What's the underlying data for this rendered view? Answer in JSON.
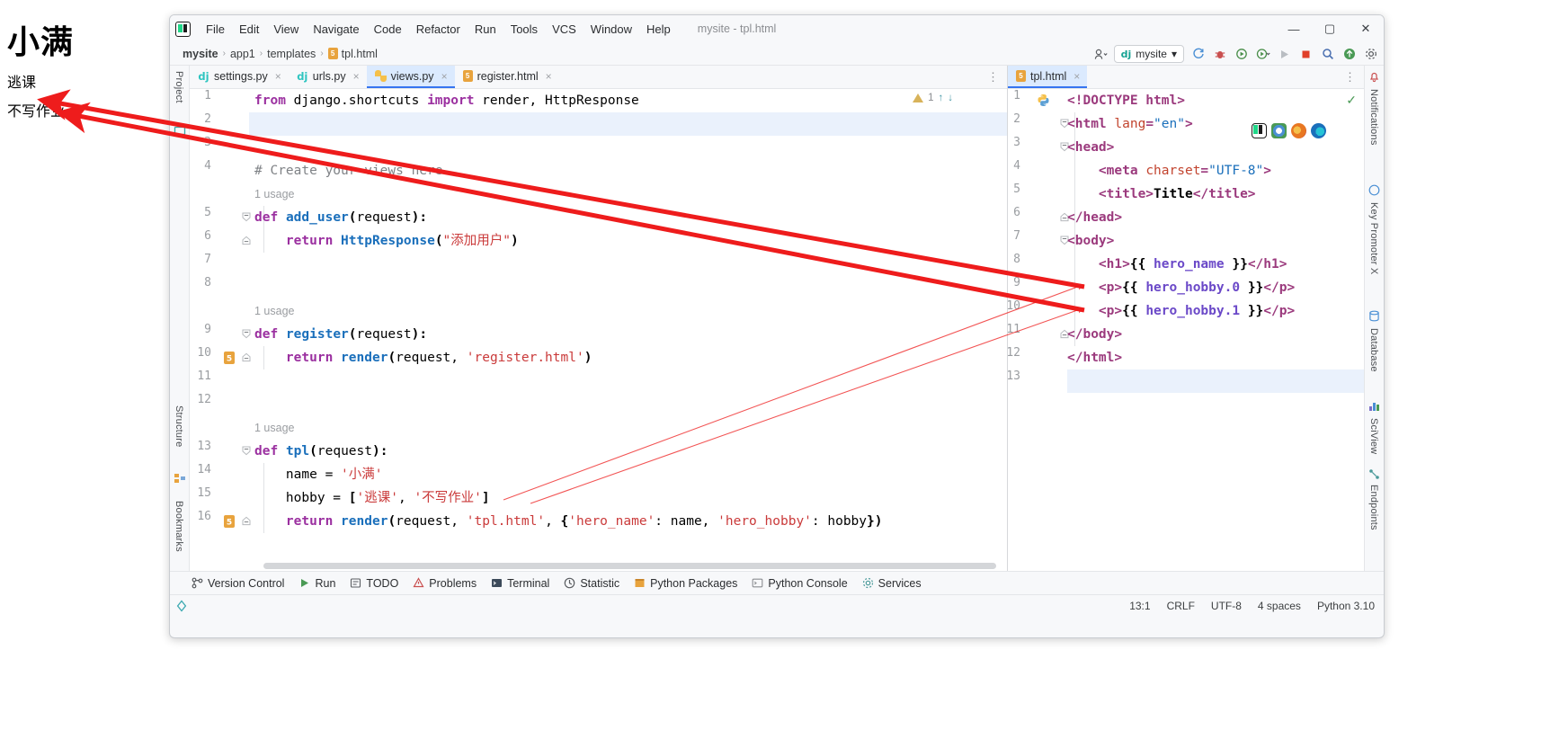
{
  "browser_page": {
    "heading": "小满",
    "paragraph_1": "逃课",
    "paragraph_2": "不写作业"
  },
  "window": {
    "title": "mysite - tpl.html",
    "minimize_label": "—",
    "maximize_label": "▢",
    "close_label": "✕"
  },
  "menu": {
    "items": [
      {
        "label": "File"
      },
      {
        "label": "Edit"
      },
      {
        "label": "View"
      },
      {
        "label": "Navigate"
      },
      {
        "label": "Code"
      },
      {
        "label": "Refactor"
      },
      {
        "label": "Run"
      },
      {
        "label": "Tools"
      },
      {
        "label": "VCS"
      },
      {
        "label": "Window"
      },
      {
        "label": "Help"
      }
    ]
  },
  "breadcrumb": {
    "items": [
      "mysite",
      "app1",
      "templates",
      "tpl.html"
    ],
    "separator": "›"
  },
  "navbar_right": {
    "run_config": "mysite",
    "dj_badge": "dj",
    "chevron": "▾",
    "icons": [
      "reload-icon",
      "debug-icon",
      "run-with-coverage-icon",
      "profile-icon",
      "run-icon",
      "stop-icon",
      "search-icon",
      "git-update-icon",
      "settings-icon"
    ],
    "user_icon": "user-icon"
  },
  "left_rail": {
    "items": [
      "Project",
      "Structure",
      "Bookmarks"
    ]
  },
  "right_rail": {
    "items": [
      "Notifications",
      "Key Promoter X",
      "Database",
      "SciView",
      "Endpoints"
    ]
  },
  "editor_left": {
    "tabs": [
      {
        "label": "settings.py",
        "icon": "django-icon",
        "active": false,
        "close": "×"
      },
      {
        "label": "urls.py",
        "icon": "django-icon",
        "active": false,
        "close": "×"
      },
      {
        "label": "views.py",
        "icon": "python-icon",
        "active": true,
        "close": "×"
      },
      {
        "label": "register.html",
        "icon": "html5-icon",
        "active": false,
        "close": "×"
      }
    ],
    "inspection": {
      "warning_count": "1",
      "up": "↑",
      "down": "↓"
    },
    "lines": [
      {
        "num": "1",
        "gutter": "",
        "fold": "",
        "tokens": [
          [
            "k",
            "from"
          ],
          [
            "pl",
            " django.shortcuts "
          ],
          [
            "k",
            "import"
          ],
          [
            "pl",
            " render, HttpResponse"
          ]
        ]
      },
      {
        "num": "2",
        "gutter": "",
        "fold": "",
        "tokens": [],
        "current": true
      },
      {
        "num": "3",
        "gutter": "",
        "fold": "",
        "tokens": []
      },
      {
        "num": "4",
        "gutter": "",
        "fold": "",
        "tokens": [
          [
            "cm",
            "# Create your views here."
          ]
        ]
      },
      {
        "num": "",
        "gutter": "",
        "fold": "",
        "hint": "1 usage"
      },
      {
        "num": "5",
        "gutter": "",
        "fold": "open",
        "tokens": [
          [
            "k",
            "def"
          ],
          [
            "pl",
            " "
          ],
          [
            "fn",
            "add_user"
          ],
          [
            "bk",
            "("
          ],
          [
            "pl",
            "request"
          ],
          [
            "bk",
            "):"
          ]
        ]
      },
      {
        "num": "6",
        "gutter": "",
        "fold": "end",
        "tokens": [
          [
            "pl",
            "    "
          ],
          [
            "k",
            "return"
          ],
          [
            "pl",
            " "
          ],
          [
            "fn",
            "HttpResponse"
          ],
          [
            "bk",
            "("
          ],
          [
            "s",
            "\"添加用户\""
          ],
          [
            "bk",
            ")"
          ]
        ]
      },
      {
        "num": "7",
        "gutter": "",
        "fold": "",
        "tokens": []
      },
      {
        "num": "8",
        "gutter": "",
        "fold": "",
        "tokens": []
      },
      {
        "num": "",
        "gutter": "",
        "fold": "",
        "hint": "1 usage"
      },
      {
        "num": "9",
        "gutter": "",
        "fold": "open",
        "tokens": [
          [
            "k",
            "def"
          ],
          [
            "pl",
            " "
          ],
          [
            "fn",
            "register"
          ],
          [
            "bk",
            "("
          ],
          [
            "pl",
            "request"
          ],
          [
            "bk",
            "):"
          ]
        ]
      },
      {
        "num": "10",
        "gutter": "html5-icon",
        "fold": "end",
        "tokens": [
          [
            "pl",
            "    "
          ],
          [
            "k",
            "return"
          ],
          [
            "pl",
            " "
          ],
          [
            "fn",
            "render"
          ],
          [
            "bk",
            "("
          ],
          [
            "pl",
            "request, "
          ],
          [
            "s",
            "'register.html'"
          ],
          [
            "bk",
            ")"
          ]
        ]
      },
      {
        "num": "11",
        "gutter": "",
        "fold": "",
        "tokens": []
      },
      {
        "num": "12",
        "gutter": "",
        "fold": "",
        "tokens": []
      },
      {
        "num": "",
        "gutter": "",
        "fold": "",
        "hint": "1 usage"
      },
      {
        "num": "13",
        "gutter": "",
        "fold": "open",
        "tokens": [
          [
            "k",
            "def"
          ],
          [
            "pl",
            " "
          ],
          [
            "fn",
            "tpl"
          ],
          [
            "bk",
            "("
          ],
          [
            "pl",
            "request"
          ],
          [
            "bk",
            "):"
          ]
        ]
      },
      {
        "num": "14",
        "gutter": "",
        "fold": "",
        "tokens": [
          [
            "pl",
            "    name = "
          ],
          [
            "s",
            "'小满'"
          ]
        ]
      },
      {
        "num": "15",
        "gutter": "",
        "fold": "",
        "tokens": [
          [
            "pl",
            "    hobby = "
          ],
          [
            "bk",
            "["
          ],
          [
            "s",
            "'逃课'"
          ],
          [
            "pl",
            ", "
          ],
          [
            "s",
            "'不写作业'"
          ],
          [
            "bk",
            "]"
          ]
        ]
      },
      {
        "num": "16",
        "gutter": "html5-icon",
        "fold": "end",
        "tokens": [
          [
            "pl",
            "    "
          ],
          [
            "k",
            "return"
          ],
          [
            "pl",
            " "
          ],
          [
            "fn",
            "render"
          ],
          [
            "bk",
            "("
          ],
          [
            "pl",
            "request, "
          ],
          [
            "s",
            "'tpl.html'"
          ],
          [
            "pl",
            ", "
          ],
          [
            "bk",
            "{"
          ],
          [
            "s",
            "'hero_name'"
          ],
          [
            "pl",
            ": name, "
          ],
          [
            "s",
            "'hero_hobby'"
          ],
          [
            "pl",
            ": hobby"
          ],
          [
            "bk",
            "})"
          ]
        ]
      }
    ]
  },
  "editor_right": {
    "tabs": [
      {
        "label": "tpl.html",
        "icon": "html5-icon",
        "active": true,
        "close": "×"
      }
    ],
    "ok_check": "✓",
    "lines": [
      {
        "num": "1",
        "gutter": "python-icon",
        "fold": "",
        "tokens": [
          [
            "tg",
            "<!DOCTYPE html>"
          ]
        ]
      },
      {
        "num": "2",
        "gutter": "",
        "fold": "open",
        "tokens": [
          [
            "tg",
            "<html "
          ],
          [
            "at",
            "lang"
          ],
          [
            "tg",
            "="
          ],
          [
            "av",
            "\"en\""
          ],
          [
            "tg",
            ">"
          ]
        ]
      },
      {
        "num": "3",
        "gutter": "",
        "fold": "open",
        "tokens": [
          [
            "tg",
            "<head>"
          ]
        ]
      },
      {
        "num": "4",
        "gutter": "",
        "fold": "",
        "tokens": [
          [
            "pl",
            "    "
          ],
          [
            "tg",
            "<meta "
          ],
          [
            "at",
            "charset"
          ],
          [
            "tg",
            "="
          ],
          [
            "av",
            "\"UTF-8\""
          ],
          [
            "tg",
            ">"
          ]
        ]
      },
      {
        "num": "5",
        "gutter": "",
        "fold": "",
        "tokens": [
          [
            "pl",
            "    "
          ],
          [
            "tg",
            "<title>"
          ],
          [
            "bk",
            "Title"
          ],
          [
            "tg",
            "</title>"
          ]
        ]
      },
      {
        "num": "6",
        "gutter": "",
        "fold": "end",
        "tokens": [
          [
            "tg",
            "</head>"
          ]
        ]
      },
      {
        "num": "7",
        "gutter": "",
        "fold": "open",
        "tokens": [
          [
            "tg",
            "<body>"
          ]
        ]
      },
      {
        "num": "8",
        "gutter": "",
        "fold": "",
        "tokens": [
          [
            "pl",
            "    "
          ],
          [
            "tg",
            "<h1>"
          ],
          [
            "bk",
            "{{ "
          ],
          [
            "dj",
            "hero_name"
          ],
          [
            "bk",
            " }}"
          ],
          [
            "tg",
            "</h1>"
          ]
        ]
      },
      {
        "num": "9",
        "gutter": "",
        "fold": "",
        "tokens": [
          [
            "pl",
            "    "
          ],
          [
            "tg",
            "<p>"
          ],
          [
            "bk",
            "{{ "
          ],
          [
            "dj",
            "hero_hobby.0"
          ],
          [
            "bk",
            " }}"
          ],
          [
            "tg",
            "</p>"
          ]
        ]
      },
      {
        "num": "10",
        "gutter": "",
        "fold": "",
        "tokens": [
          [
            "pl",
            "    "
          ],
          [
            "tg",
            "<p>"
          ],
          [
            "bk",
            "{{ "
          ],
          [
            "dj",
            "hero_hobby.1"
          ],
          [
            "bk",
            " }}"
          ],
          [
            "tg",
            "</p>"
          ]
        ]
      },
      {
        "num": "11",
        "gutter": "",
        "fold": "end",
        "tokens": [
          [
            "tg",
            "</body>"
          ]
        ]
      },
      {
        "num": "12",
        "gutter": "",
        "fold": "",
        "tokens": [
          [
            "tg",
            "</html>"
          ]
        ]
      },
      {
        "num": "13",
        "gutter": "",
        "fold": "",
        "tokens": [],
        "current": true
      }
    ],
    "float_icons": [
      "pycharm-icon",
      "chrome-icon",
      "firefox-icon",
      "edge-icon"
    ]
  },
  "bottom_bar": {
    "items": [
      {
        "label": "Version Control",
        "icon": "branch-icon"
      },
      {
        "label": "Run",
        "icon": "run-icon"
      },
      {
        "label": "TODO",
        "icon": "todo-icon"
      },
      {
        "label": "Problems",
        "icon": "problems-icon"
      },
      {
        "label": "Terminal",
        "icon": "terminal-icon"
      },
      {
        "label": "Statistic",
        "icon": "statistic-icon"
      },
      {
        "label": "Python Packages",
        "icon": "packages-icon"
      },
      {
        "label": "Python Console",
        "icon": "console-icon"
      },
      {
        "label": "Services",
        "icon": "services-icon"
      }
    ]
  },
  "status_bar": {
    "caret_position": "13:1",
    "line_separator": "CRLF",
    "encoding": "UTF-8",
    "indent": "4 spaces",
    "interpreter": "Python 3.10"
  },
  "colors": {
    "accent_blue": "#3574f0",
    "tab_active_bg": "#dbeafe",
    "annotation_red": "#ee1c1c",
    "keyword_purple": "#9b30a0",
    "string_red": "#ca3a3a",
    "tag_magenta": "#9b3a7d",
    "django_var": "#6b49c8",
    "chrome_bg": "#f7f8fa"
  },
  "annotations": {
    "arrows": [
      {
        "name": "arrow-to-hobby-0",
        "from": "逃课",
        "to": "hero_hobby.0"
      },
      {
        "name": "arrow-to-hobby-1",
        "from": "不写作业",
        "to": "hero_hobby.1"
      }
    ]
  }
}
